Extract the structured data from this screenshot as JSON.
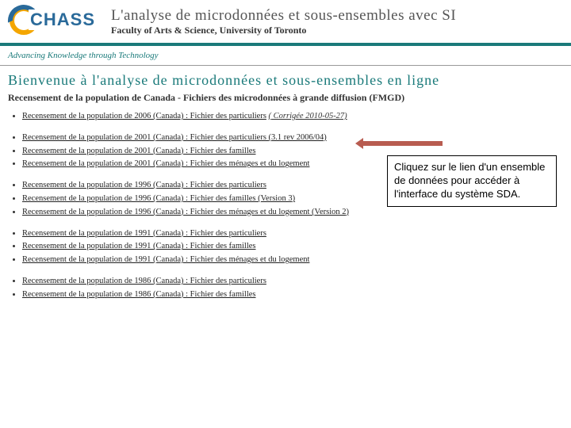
{
  "logo": {
    "text": "CHASS"
  },
  "header": {
    "title": "L'analyse de microdonnées et sous-ensembles avec SI",
    "subtitle": "Faculty of Arts & Science, University of Toronto"
  },
  "tagline": "Advancing Knowledge through Technology",
  "welcome": "Bienvenue à l'analyse de microdonnées et sous-ensembles en ligne",
  "section_title": "Recensement de la population de Canada - Fichiers des microdonnées à grande diffusion (FMGD)",
  "groups": [
    {
      "items": [
        {
          "label": "Recensement de la population de 2006 (Canada) : Fichier des particuliers",
          "note": "( Corrigée 2010-05-27)"
        }
      ]
    },
    {
      "items": [
        {
          "label": "Recensement de la population de 2001 (Canada) : Fichier des particuliers (3.1 rev 2006/04)"
        },
        {
          "label": "Recensement de la population de 2001 (Canada) : Fichier des familles"
        },
        {
          "label": "Recensement de la population de 2001 (Canada) : Fichier des ménages et du logement"
        }
      ]
    },
    {
      "items": [
        {
          "label": "Recensement de la population de 1996 (Canada) : Fichier des particuliers"
        },
        {
          "label": "Recensement de la population de 1996 (Canada) : Fichier des familles (Version 3)"
        },
        {
          "label": "Recensement de la population de 1996 (Canada) : Fichier des ménages et du logement (Version 2)"
        }
      ]
    },
    {
      "items": [
        {
          "label": "Recensement de la population de 1991 (Canada) : Fichier des particuliers"
        },
        {
          "label": "Recensement de la population de 1991 (Canada) : Fichier des familles"
        },
        {
          "label": "Recensement de la population de 1991 (Canada) : Fichier des ménages et du logement"
        }
      ]
    },
    {
      "items": [
        {
          "label": "Recensement de la population de 1986 (Canada) : Fichier des particuliers"
        },
        {
          "label": "Recensement de la population de 1986 (Canada) : Fichier des familles"
        }
      ]
    }
  ],
  "callout": "Cliquez sur le lien d'un ensemble de données pour accéder à l'interface du système SDA."
}
